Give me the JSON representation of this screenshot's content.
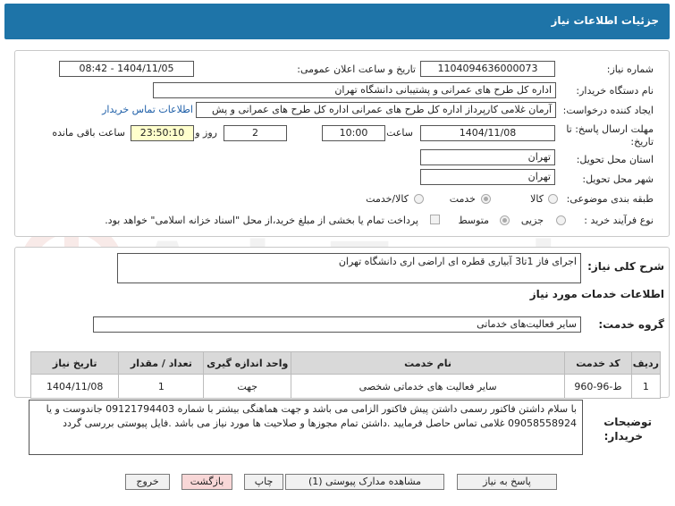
{
  "header": {
    "title": "جزئیات اطلاعات نیاز"
  },
  "form": {
    "need_number_label": "شماره نیاز:",
    "need_number": "1104094636000073",
    "announce_label": "تاریخ و ساعت اعلان عمومی:",
    "announce_value": "1404/11/05 - 08:42",
    "buyer_org_label": "نام دستگاه خریدار:",
    "buyer_org": "اداره کل طرح های عمرانی و پشتیبانی دانشگاه تهران",
    "creator_label": "ایجاد کننده درخواست:",
    "creator": "آرمان غلامی کارپرداز اداره کل طرح های عمرانی اداره کل طرح های عمرانی و پش",
    "contact_link": "اطلاعات تماس خریدار",
    "deadline_label_1": "مهلت ارسال پاسخ: تا",
    "deadline_label_2": "تاریخ:",
    "deadline_date": "1404/11/08",
    "time_label": "ساعت",
    "deadline_time": "10:00",
    "days_value": "2",
    "days_label": "روز و",
    "remaining_time": "23:50:10",
    "remaining_label": "ساعت باقی مانده",
    "province_label": "استان محل تحویل:",
    "province": "تهران",
    "city_label": "شهر محل تحویل:",
    "city": "تهران",
    "category_label": "طبقه بندی موضوعی:",
    "category_options": [
      "کالا",
      "خدمت",
      "کالا/خدمت"
    ],
    "category_selected": "خدمت",
    "process_label": "نوع فرآیند خرید :",
    "process_options": [
      "جزیی",
      "متوسط"
    ],
    "process_selected": "متوسط",
    "payment_text": "پرداخت تمام یا بخشی از مبلغ خرید،از محل \"اسناد خزانه اسلامی\" خواهد بود."
  },
  "summary": {
    "label": "شرح کلی نیاز:",
    "value": "اجرای فاز 1تا3 آبیاری قطره ای اراضی اری دانشگاه تهران"
  },
  "services": {
    "section_title": "اطلاعات خدمات مورد نیاز",
    "group_label": "گروه خدمت:",
    "group_value": "سایر فعالیت‌های خدماتی",
    "columns": [
      "ردیف",
      "کد خدمت",
      "نام خدمت",
      "واحد اندازه گیری",
      "تعداد / مقدار",
      "تاریخ نیاز"
    ],
    "rows": [
      [
        "1",
        "ط-96-960",
        "سایر فعالیت های خدماتی شخصی",
        "جهت",
        "1",
        "1404/11/08"
      ]
    ]
  },
  "buyer_notes": {
    "label_1": "توضیحات",
    "label_2": "خریدار:",
    "text": "با سلام داشتن فاکتور رسمی داشتن پیش فاکتور الزامی می باشد و جهت هماهنگی بیشتر با شماره 09121794403 جاندوست و یا 09058558924 غلامی تماس حاصل فرمایید .داشتن تمام مجوزها و صلاحیت ها مورد نیاز می باشد .فایل پیوستی بررسی گردد"
  },
  "buttons": {
    "reply": "پاسخ به نیاز",
    "attachments": "مشاهده مدارک پیوستی (1)",
    "print": "چاپ",
    "back": "بازگشت",
    "exit": "خروج"
  },
  "watermark": {
    "text": "AriaTender.net"
  },
  "colors": {
    "header": "#1e74a8",
    "link": "#1e5fa8",
    "remaining_bg": "#ffffcc",
    "back_bg": "#f8d7d7"
  }
}
